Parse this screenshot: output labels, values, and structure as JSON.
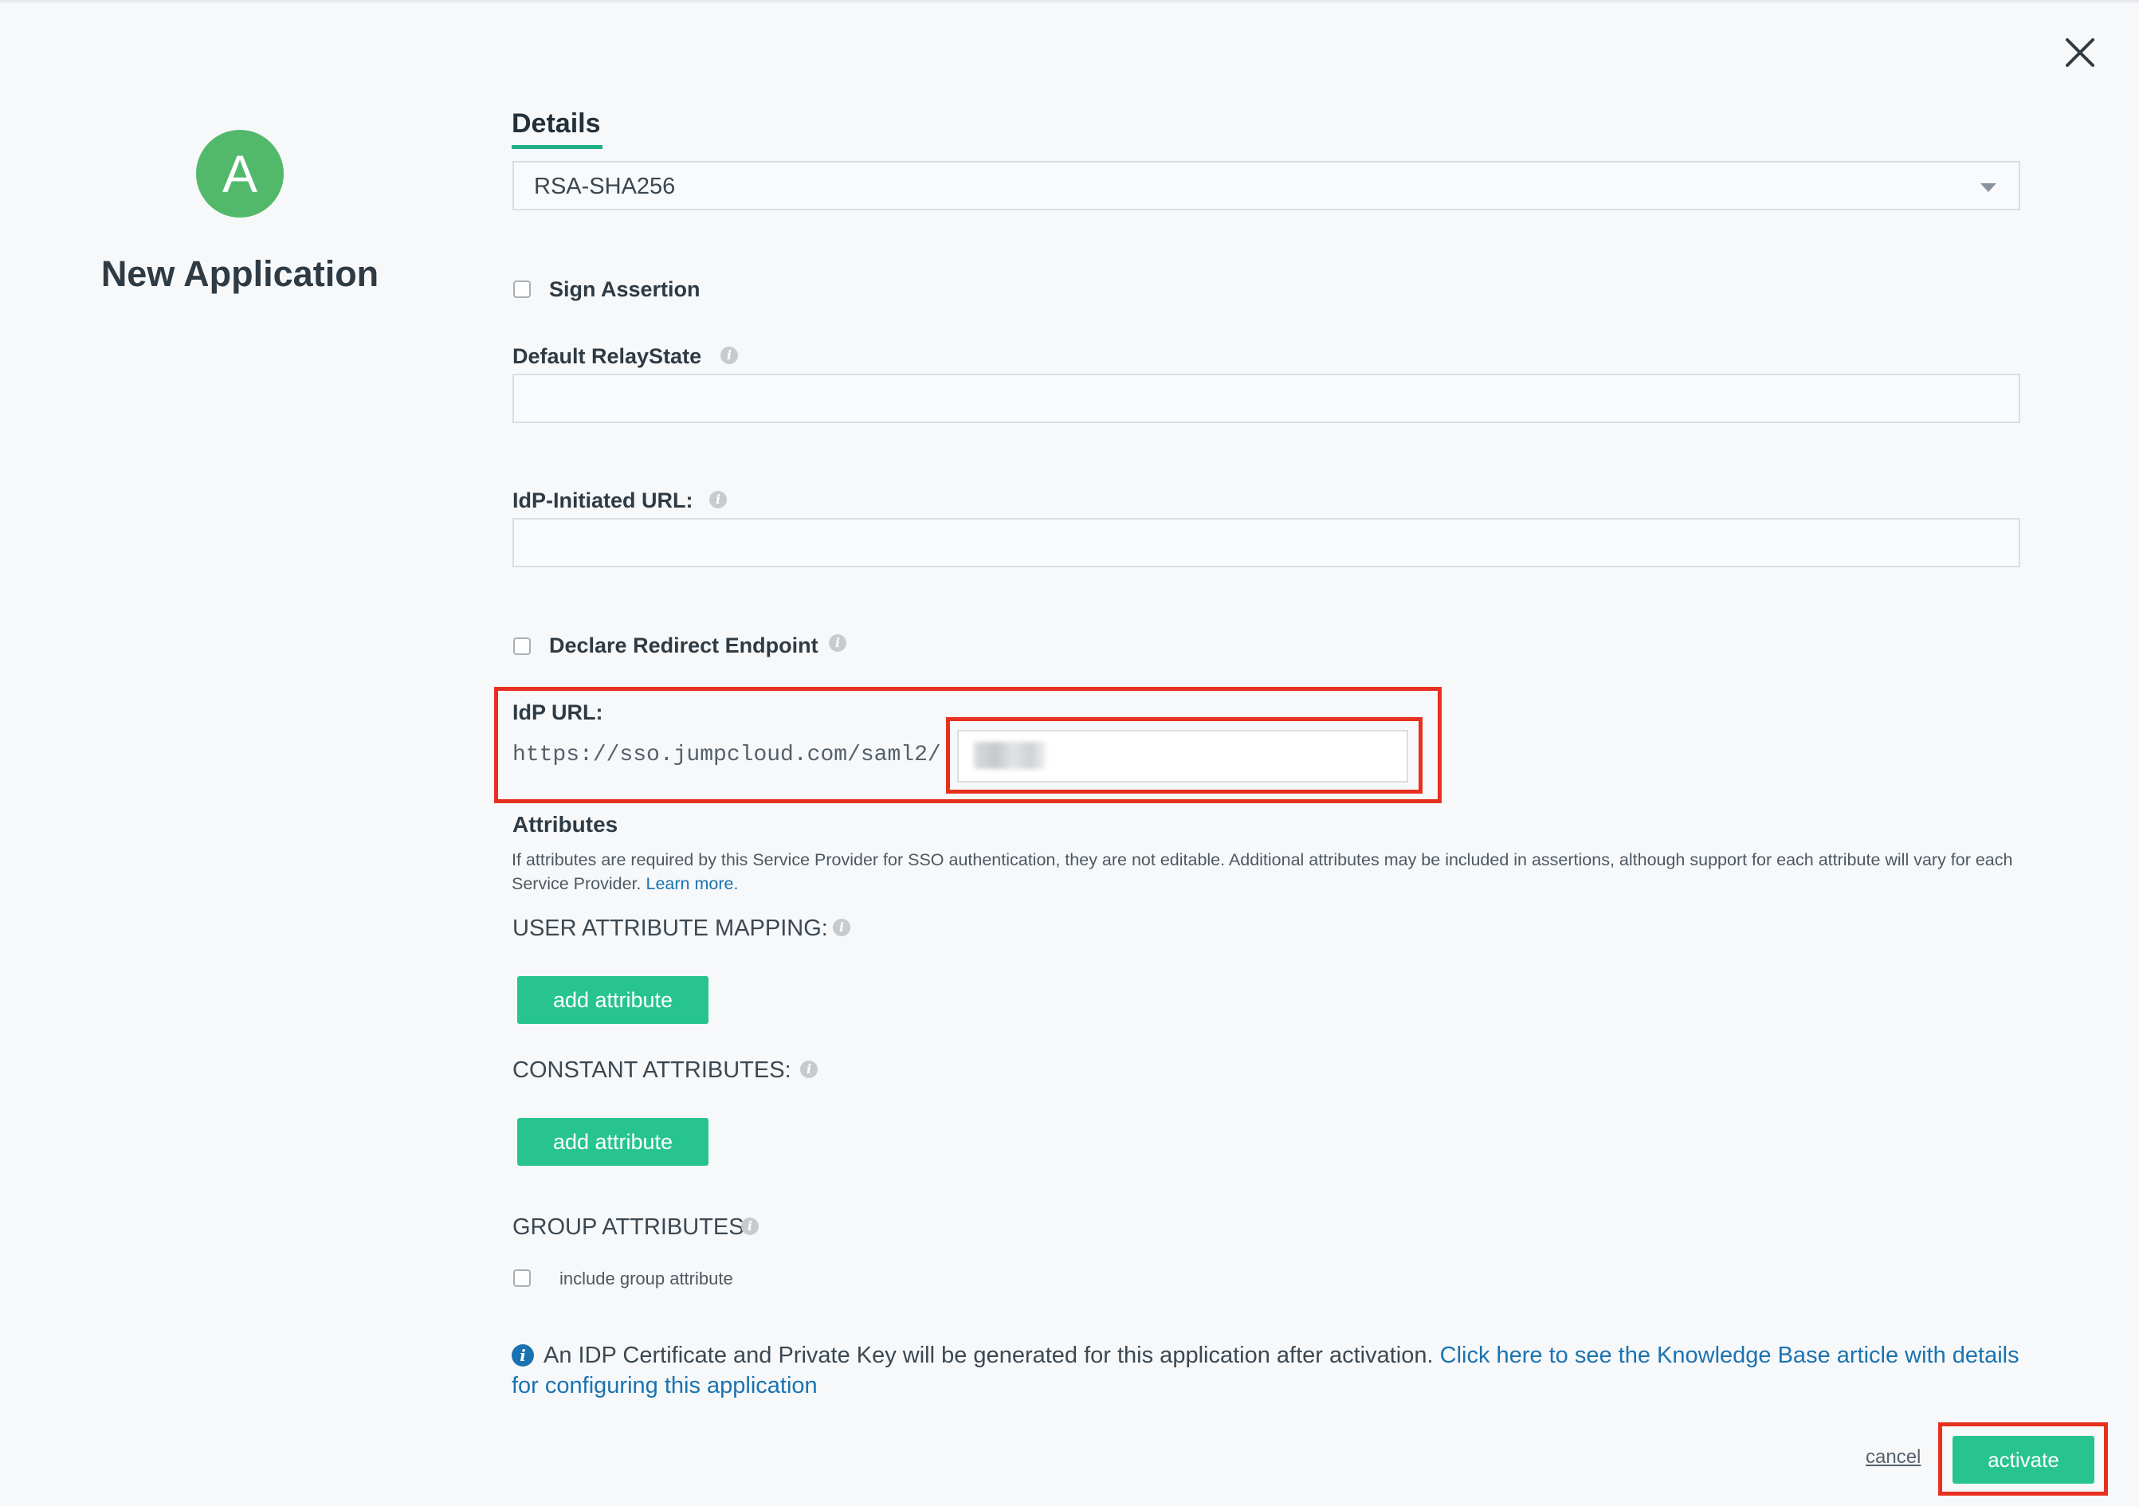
{
  "close_icon": "close-icon",
  "app": {
    "avatar_letter": "A",
    "title": "New Application"
  },
  "tab": {
    "label": "Details"
  },
  "signature_algorithm": {
    "selected": "RSA-SHA256"
  },
  "sign_assertion": {
    "label": "Sign Assertion",
    "checked": false
  },
  "relay_state": {
    "label": "Default RelayState",
    "value": ""
  },
  "idp_initiated": {
    "label": "IdP-Initiated URL:",
    "value": ""
  },
  "declare_redirect": {
    "label": "Declare Redirect Endpoint",
    "checked": false
  },
  "idp_url": {
    "label": "IdP URL:",
    "prefix": "https://sso.jumpcloud.com/saml2/",
    "value": ""
  },
  "attributes": {
    "heading": "Attributes",
    "description": "If attributes are required by this Service Provider for SSO authentication, they are not editable. Additional attributes may be included in assertions, although support for each attribute will vary for each Service Provider.",
    "learn_more": "Learn more.",
    "user_mapping_label": "USER ATTRIBUTE MAPPING:",
    "add_attribute_label": "add attribute",
    "constant_label": "CONSTANT ATTRIBUTES:",
    "group_label": "GROUP ATTRIBUTES",
    "include_group_label": "include group attribute"
  },
  "notice": {
    "text": "An IDP Certificate and Private Key will be generated for this application after activation.",
    "link": "Click here to see the Knowledge Base article with details for configuring this application"
  },
  "footer": {
    "cancel_label": "cancel",
    "activate_label": "activate"
  },
  "colors": {
    "accent": "#27c48f",
    "highlight": "#e8301f",
    "link": "#1a73b0",
    "avatar": "#52b96b"
  }
}
